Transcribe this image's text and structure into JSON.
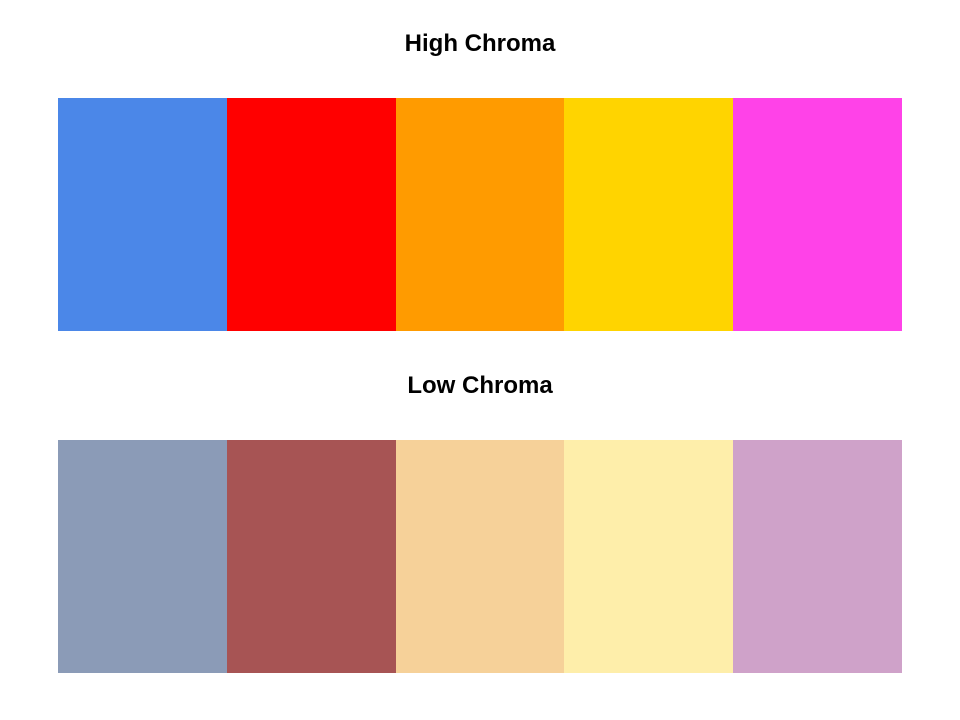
{
  "panels": [
    {
      "title": "High Chroma",
      "swatches": [
        {
          "color": "#4b87e8"
        },
        {
          "color": "#ff0000"
        },
        {
          "color": "#ff9b00"
        },
        {
          "color": "#ffd400"
        },
        {
          "color": "#ff42e8"
        }
      ]
    },
    {
      "title": "Low Chroma",
      "swatches": [
        {
          "color": "#8b9bb7"
        },
        {
          "color": "#a75454"
        },
        {
          "color": "#f6d199"
        },
        {
          "color": "#feeeaa"
        },
        {
          "color": "#cfa2c9"
        }
      ]
    }
  ]
}
